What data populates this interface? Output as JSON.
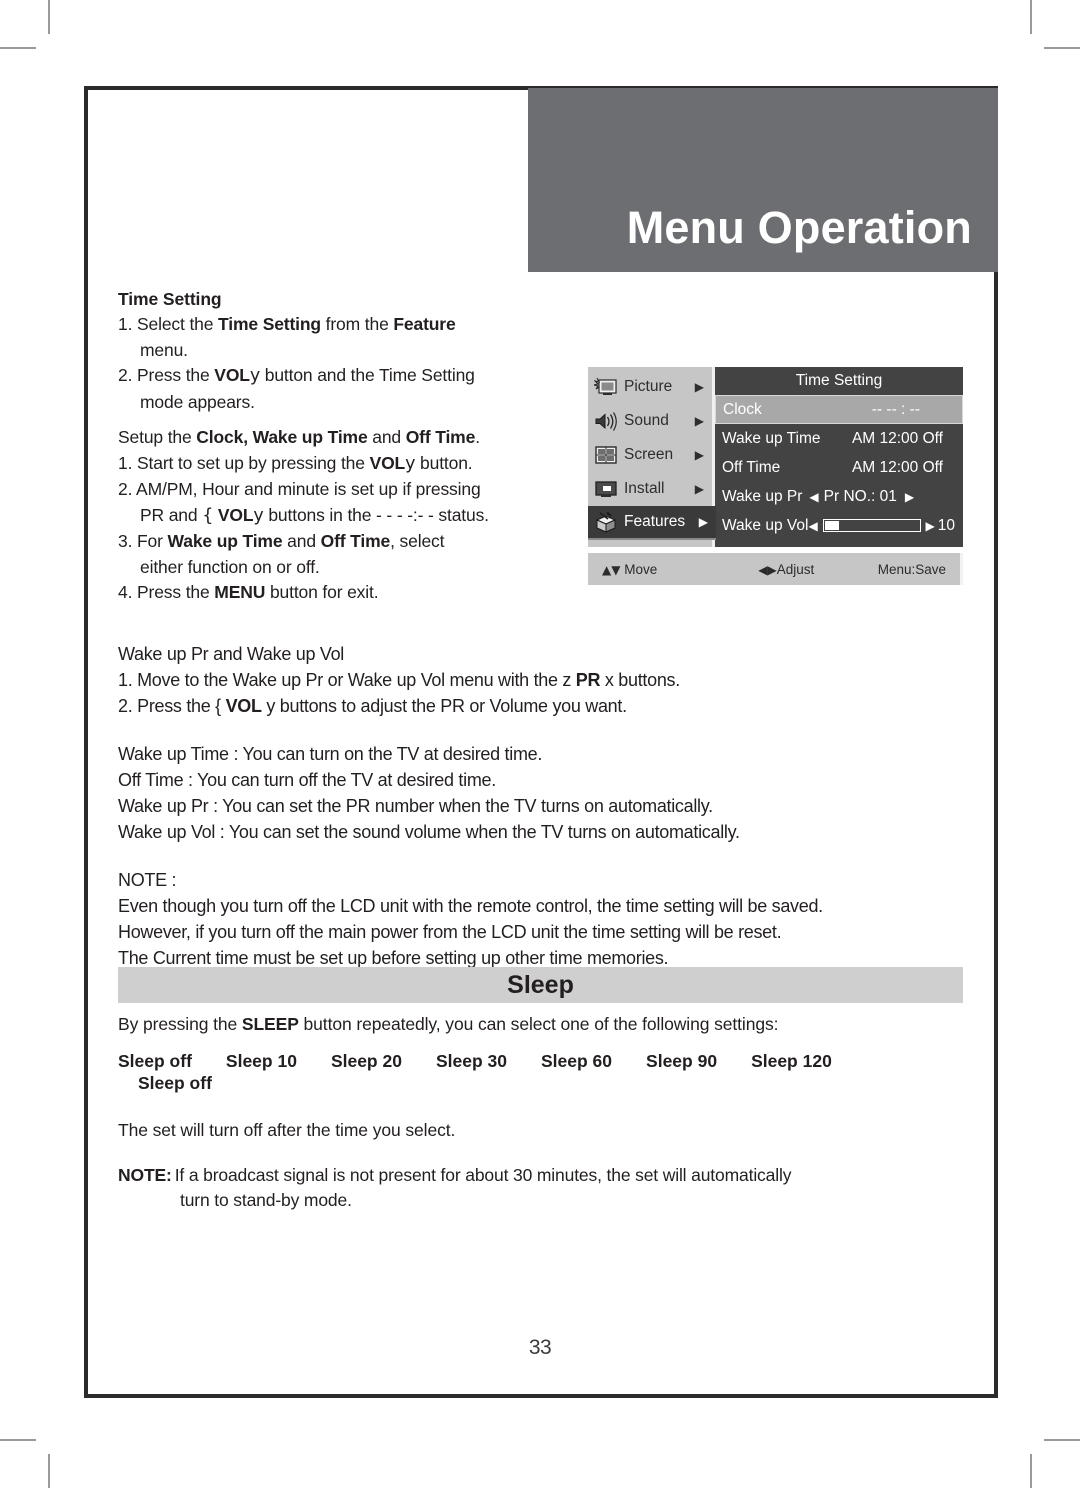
{
  "header": {
    "chapter_title": "Menu Operation"
  },
  "time_setting": {
    "heading": "Time Setting",
    "step1_a": "1. Select the ",
    "step1_b": "Time Setting",
    "step1_c": " from the ",
    "step1_d": "Feature",
    "step1_e": "menu.",
    "step2_a": "2. Press the ",
    "step2_b": "VOL",
    "step2_c": "y",
    "step2_d": " button and the Time Setting",
    "step2_e": "mode appears.",
    "setup_a": "Setup the ",
    "setup_b": "Clock, Wake up Time",
    "setup_c": " and ",
    "setup_d": "Off Time",
    "setup_e": ".",
    "s1_a": "1. Start to set up by pressing the ",
    "s1_b": "VOL",
    "s1_c": "y",
    "s1_d": " button.",
    "s2_a": "2. AM/PM, Hour and minute is set up if pressing",
    "s2_b": "PR and ",
    "s2_c": "{",
    "s2_d": "VOL",
    "s2_e": "y",
    "s2_f": " buttons in the - - - -:- - status.",
    "s3_a": "3. For ",
    "s3_b": "Wake up Time",
    "s3_c": " and ",
    "s3_d": "Off Time",
    "s3_e": ", select",
    "s3_f": "either function on or off.",
    "s4_a": "4. Press the ",
    "s4_b": "MENU",
    "s4_c": " button for exit."
  },
  "osd": {
    "sidebar": [
      {
        "label": "Picture",
        "icon": "picture-icon",
        "arrow": "▶",
        "selected": false
      },
      {
        "label": "Sound",
        "icon": "sound-icon",
        "arrow": "▶",
        "selected": false
      },
      {
        "label": "Screen",
        "icon": "screen-icon",
        "arrow": "▶",
        "selected": false
      },
      {
        "label": "Install",
        "icon": "install-icon",
        "arrow": "▶",
        "selected": false
      },
      {
        "label": "Features",
        "icon": "features-icon",
        "arrow": "▶",
        "selected": true
      }
    ],
    "panel_title": "Time Setting",
    "rows": {
      "clock_label": "Clock",
      "clock_value": "--  --  :  --",
      "wake_time_label": "Wake up Time",
      "wake_time_value": "AM 12:00 Off",
      "off_time_label": "Off Time",
      "off_time_value": "AM 12:00 Off",
      "wake_pr_label": "Wake up Pr",
      "wake_pr_left": "◀",
      "wake_pr_value": "Pr NO.: 01",
      "wake_pr_right": "▶",
      "wake_vol_label": "Wake up Vol",
      "wake_vol_left": "◀",
      "wake_vol_right": "▶",
      "wake_vol_value": "10"
    },
    "footer": {
      "move_icons": "▲▼",
      "move_label": " Move",
      "adjust_icons": "◀▶",
      "adjust_label": "Adjust",
      "save_label": "Menu:Save"
    }
  },
  "mid": {
    "l1": "Wake up Pr and Wake up Vol",
    "l2_a": "1. Move to the Wake up Pr or Wake up Vol menu with the z ",
    "l2_b": "PR",
    "l2_c": " x  buttons.",
    "l3_a": "2. Press the { ",
    "l3_b": "VOL",
    "l3_c": " y  buttons to adjust the PR or Volume you want.",
    "l4": "Wake up Time : You can turn on the TV at desired time.",
    "l5": "Off Time : You can turn off the TV at desired time.",
    "l6": "Wake up Pr : You can set the PR number when the TV turns on automatically.",
    "l7": "Wake up Vol : You can set the sound volume when the TV turns on automatically.",
    "l8": "NOTE :",
    "l9": "Even though you turn off the LCD unit with the remote control, the time setting will be saved.",
    "l10": "However, if you turn off the main power from the LCD unit the time setting will be reset.",
    "l11": "The  Current time  must be set up before setting up other time memories."
  },
  "sleep": {
    "banner_title": "Sleep",
    "intro_a": "By pressing the ",
    "intro_b": "SLEEP",
    "intro_c": " button repeatedly, you can select one of the following settings:",
    "options": [
      "Sleep off",
      "Sleep 10",
      "Sleep 20",
      "Sleep 30",
      "Sleep 60",
      "Sleep 90",
      "Sleep 120"
    ],
    "options_wrap": "Sleep off",
    "after": "The set will turn off after the time you select.",
    "note_label": "NOTE:",
    "note_text": "If a broadcast signal is not present for about 30 minutes, the set will automatically",
    "note_cont": "turn to stand-by mode."
  },
  "page_number": "33",
  "colors": {
    "header_gray": "#6d6e71",
    "banner_gray": "#cfcfcf",
    "osd_panel": "#434343",
    "osd_sidebar": "#c6c6c6",
    "osd_selected": "#3a3a3a",
    "osd_highlight": "#a8a8a8",
    "frame": "#2b2b2b"
  }
}
